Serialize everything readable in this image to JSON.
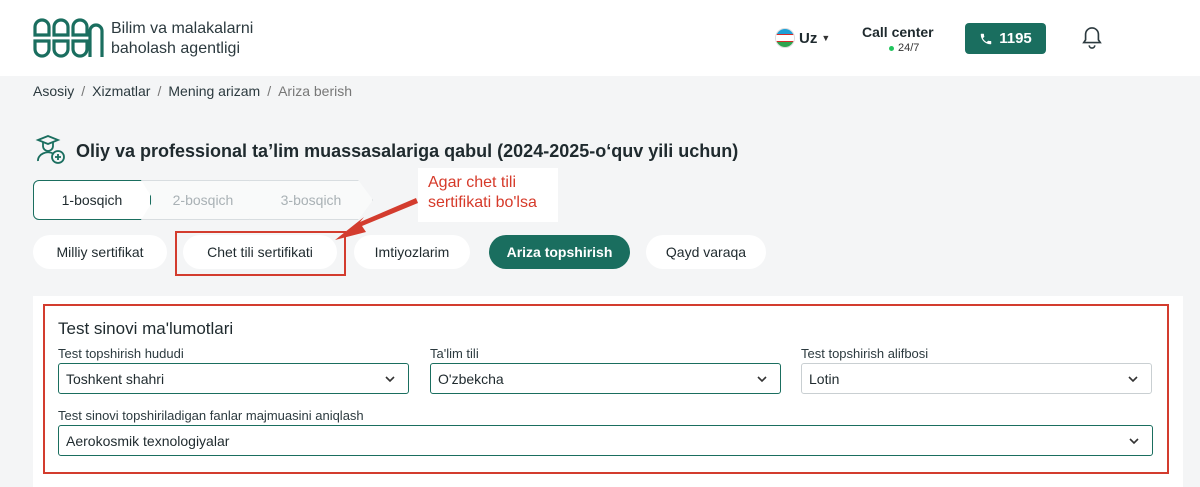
{
  "header": {
    "brand_line1": "Bilim va malakalarni",
    "brand_line2": "baholash agentligi",
    "logo_icon": "agency-logo",
    "language": "Uz",
    "call_center_title": "Call center",
    "call_center_hours": "24/7",
    "phone_number": "1195",
    "accent_color": "#1a6e5f"
  },
  "breadcrumb": [
    "Asosiy",
    "Xizmatlar",
    "Mening arizam",
    "Ariza berish"
  ],
  "page_title": "Oliy va professional ta’lim muassasalariga qabul (2024-2025-o‘quv yili uchun)",
  "steps": [
    "1-bosqich",
    "2-bosqich",
    "3-bosqich"
  ],
  "callout": {
    "line1": "Agar chet tili",
    "line2": "sertifikati bo'lsa",
    "color": "#d33c2e"
  },
  "tabs": [
    {
      "label": "Milliy sertifikat",
      "active": false
    },
    {
      "label": "Chet tili sertifikati",
      "active": false
    },
    {
      "label": "Imtiyozlarim",
      "active": false
    },
    {
      "label": "Ariza topshirish",
      "active": true
    },
    {
      "label": "Qayd varaqa",
      "active": false
    }
  ],
  "form": {
    "title": "Test sinovi ma'lumotlari",
    "fields": [
      {
        "label": "Test topshirish hududi",
        "value": "Toshkent shahri"
      },
      {
        "label": "Ta'lim tili",
        "value": "O'zbekcha"
      },
      {
        "label": "Test topshirish alifbosi",
        "value": "Lotin"
      },
      {
        "label": "Test sinovi topshiriladigan fanlar majmuasini aniqlash",
        "value": "Aerokosmik texnologiyalar"
      }
    ]
  }
}
